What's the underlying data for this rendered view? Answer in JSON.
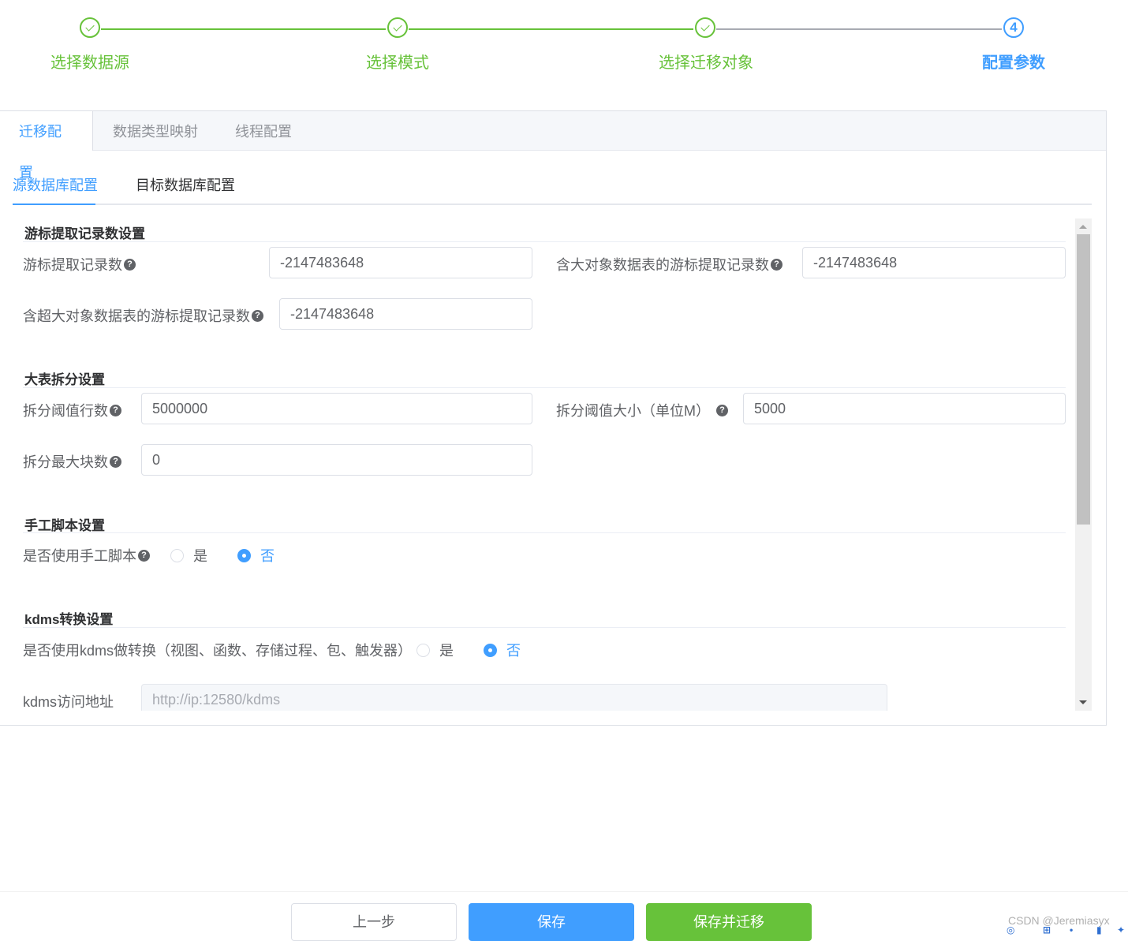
{
  "steps": [
    {
      "title": "选择数据源",
      "status": "done"
    },
    {
      "title": "选择模式",
      "status": "done"
    },
    {
      "title": "选择迁移对象",
      "status": "done"
    },
    {
      "title": "配置参数",
      "status": "active",
      "number": "4"
    }
  ],
  "tabs": [
    "迁移配置",
    "数据类型映射",
    "线程配置"
  ],
  "subtabs": [
    "源数据库配置",
    "目标数据库配置"
  ],
  "sections": {
    "cursor": {
      "title": "游标提取记录数设置",
      "fetch_label": "游标提取记录数",
      "fetch_value": "-2147483648",
      "lob_label": "含大对象数据表的游标提取记录数",
      "lob_value": "-2147483648",
      "super_lob_label": "含超大对象数据表的游标提取记录数",
      "super_lob_value": "-2147483648"
    },
    "split": {
      "title": "大表拆分设置",
      "rows_label": "拆分阈值行数",
      "rows_value": "5000000",
      "size_label": "拆分阈值大小（单位M）",
      "size_value": "5000",
      "blocks_label": "拆分最大块数",
      "blocks_value": "0"
    },
    "manual": {
      "title": "手工脚本设置",
      "label": "是否使用手工脚本",
      "yes": "是",
      "no": "否",
      "selected": "否"
    },
    "kdms": {
      "title": "kdms转换设置",
      "label": "是否使用kdms做转换（视图、函数、存储过程、包、触发器）",
      "yes": "是",
      "no": "否",
      "selected": "否",
      "url_label": "kdms访问地址",
      "url_placeholder": "http://ip:12580/kdms"
    }
  },
  "buttons": {
    "prev": "上一步",
    "save": "保存",
    "save_migrate": "保存并迁移"
  },
  "watermark": "CSDN @Jeremiasyx",
  "colors": {
    "primary": "#409eff",
    "success": "#67c23a",
    "text": "#606266"
  }
}
